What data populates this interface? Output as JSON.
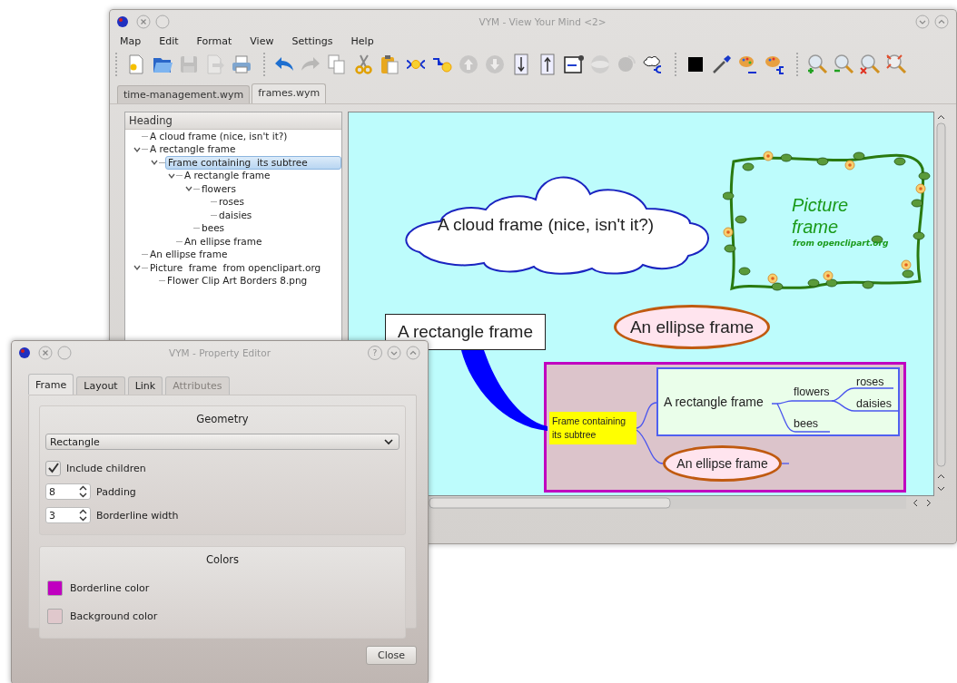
{
  "window": {
    "title": "VYM - View Your Mind <2>"
  },
  "menu": [
    "Map",
    "Edit",
    "Format",
    "View",
    "Settings",
    "Help"
  ],
  "toolbar_groups": [
    {
      "buttons": [
        {
          "kind": "new",
          "disabled": false
        },
        {
          "kind": "open",
          "disabled": false
        },
        {
          "kind": "save",
          "disabled": true
        },
        {
          "kind": "export",
          "disabled": true
        },
        {
          "kind": "print",
          "disabled": false
        }
      ]
    },
    {
      "buttons": [
        {
          "kind": "undo",
          "disabled": false
        },
        {
          "kind": "redo",
          "disabled": true
        },
        {
          "kind": "copy",
          "disabled": false
        },
        {
          "kind": "cut",
          "disabled": false
        },
        {
          "kind": "paste",
          "disabled": false
        },
        {
          "kind": "addbranch",
          "disabled": false
        },
        {
          "kind": "addbefore",
          "disabled": false
        },
        {
          "kind": "up",
          "disabled": true
        },
        {
          "kind": "down",
          "disabled": true
        },
        {
          "kind": "sortaz",
          "disabled": false
        },
        {
          "kind": "sortza",
          "disabled": false
        },
        {
          "kind": "frame",
          "disabled": false
        },
        {
          "kind": "globe",
          "disabled": true
        },
        {
          "kind": "head",
          "disabled": true
        },
        {
          "kind": "cloud",
          "disabled": false
        }
      ]
    },
    {
      "buttons": [
        {
          "kind": "color",
          "disabled": false
        },
        {
          "kind": "picker",
          "disabled": false
        },
        {
          "kind": "palette",
          "disabled": false
        },
        {
          "kind": "palettebranch",
          "disabled": false
        }
      ]
    },
    {
      "buttons": [
        {
          "kind": "zoomin",
          "disabled": false
        },
        {
          "kind": "zoomout",
          "disabled": false
        },
        {
          "kind": "zoomreset",
          "disabled": false
        },
        {
          "kind": "zoomfit",
          "disabled": false
        }
      ]
    }
  ],
  "tabs": [
    {
      "label": "time-management.wym",
      "selected": false
    },
    {
      "label": "frames.wym",
      "selected": true
    }
  ],
  "tree": {
    "heading": "Heading",
    "items": [
      {
        "label": "A cloud frame (nice, isn't it?)",
        "selected": false,
        "expanded": false
      },
      {
        "label": "A rectangle frame",
        "selected": false,
        "expanded": true,
        "children": [
          {
            "label": "Frame containing  its subtree",
            "selected": true,
            "expanded": true,
            "children": [
              {
                "label": "A rectangle frame",
                "selected": false,
                "expanded": true,
                "children": [
                  {
                    "label": "flowers",
                    "selected": false,
                    "expanded": true,
                    "children": [
                      {
                        "label": "roses",
                        "selected": false,
                        "expanded": false
                      },
                      {
                        "label": "daisies",
                        "selected": false,
                        "expanded": false
                      }
                    ]
                  },
                  {
                    "label": "bees",
                    "selected": false,
                    "expanded": false
                  }
                ]
              },
              {
                "label": "An ellipse frame",
                "selected": false,
                "expanded": false
              }
            ]
          }
        ]
      },
      {
        "label": "An ellipse frame",
        "selected": false,
        "expanded": false
      },
      {
        "label": "Picture  frame  from openclipart.org",
        "selected": false,
        "expanded": true,
        "children": [
          {
            "label": "Flower Clip Art Borders 8.png",
            "selected": false,
            "expanded": false
          }
        ]
      }
    ]
  },
  "map": {
    "cloud_node": {
      "text": "A cloud frame (nice, isn't it?)"
    },
    "picture_node": {
      "title": "Picture frame",
      "credit": "from openclipart.org"
    },
    "rectangle_node": {
      "text": "A rectangle frame"
    },
    "ellipse_node": {
      "text": "An ellipse frame"
    },
    "subtree_frame": {
      "text": "Frame containing its subtree",
      "inner_frame": {
        "text": "A rectangle frame",
        "branches": [
          {
            "text": "flowers",
            "children": [
              {
                "text": "roses"
              },
              {
                "text": "daisies"
              }
            ]
          },
          {
            "text": "bees"
          }
        ]
      },
      "ellipse": {
        "text": "An ellipse frame"
      }
    }
  },
  "property_editor": {
    "title": "VYM - Property Editor",
    "help_button": "?",
    "tabs": [
      {
        "label": "Frame",
        "selected": true,
        "disabled": false
      },
      {
        "label": "Layout",
        "selected": false,
        "disabled": false
      },
      {
        "label": "Link",
        "selected": false,
        "disabled": false
      },
      {
        "label": "Attributes",
        "selected": false,
        "disabled": true
      }
    ],
    "geometry": {
      "title": "Geometry",
      "shape": "Rectangle",
      "include_children": {
        "label": "Include children",
        "checked": true
      },
      "spinners": [
        {
          "value": "8",
          "label": "Padding"
        },
        {
          "value": "3",
          "label": "Borderline width"
        }
      ]
    },
    "colors": {
      "title": "Colors",
      "items": [
        {
          "label": "Borderline color",
          "color": "#c000c0"
        },
        {
          "label": "Background color",
          "color": "#e0c8cc"
        }
      ]
    },
    "close_button": "Close"
  }
}
